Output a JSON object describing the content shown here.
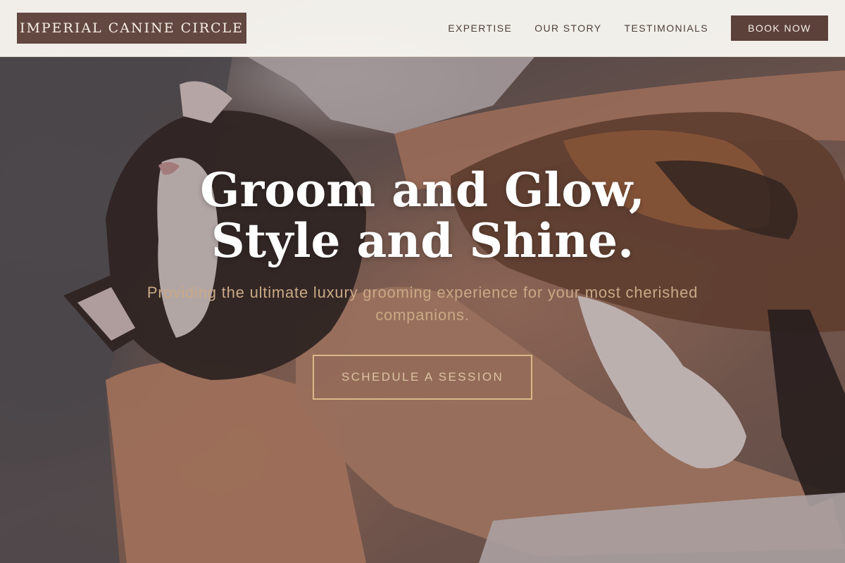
{
  "brand": {
    "name": "IMPERIAL CANINE CIRCLE"
  },
  "nav": {
    "items": [
      {
        "label": "EXPERTISE"
      },
      {
        "label": "OUR STORY"
      },
      {
        "label": "TESTIMONIALS"
      }
    ],
    "book_label": "BOOK NOW"
  },
  "hero": {
    "headline_line1": "Groom and Glow,",
    "headline_line2": "Style and Shine.",
    "subtext": "Providing the ultimate luxury grooming experience for your most cherished companions.",
    "cta_label": "SCHEDULE A SESSION",
    "background_image": "cat-held-in-arms-photo"
  },
  "colors": {
    "brand": "#634741",
    "button": "#5c403a",
    "header_bg": "#f8f6f0",
    "nav_text": "#4e3e39",
    "accent_gold": "#d8b887",
    "headline": "#ffffff"
  }
}
